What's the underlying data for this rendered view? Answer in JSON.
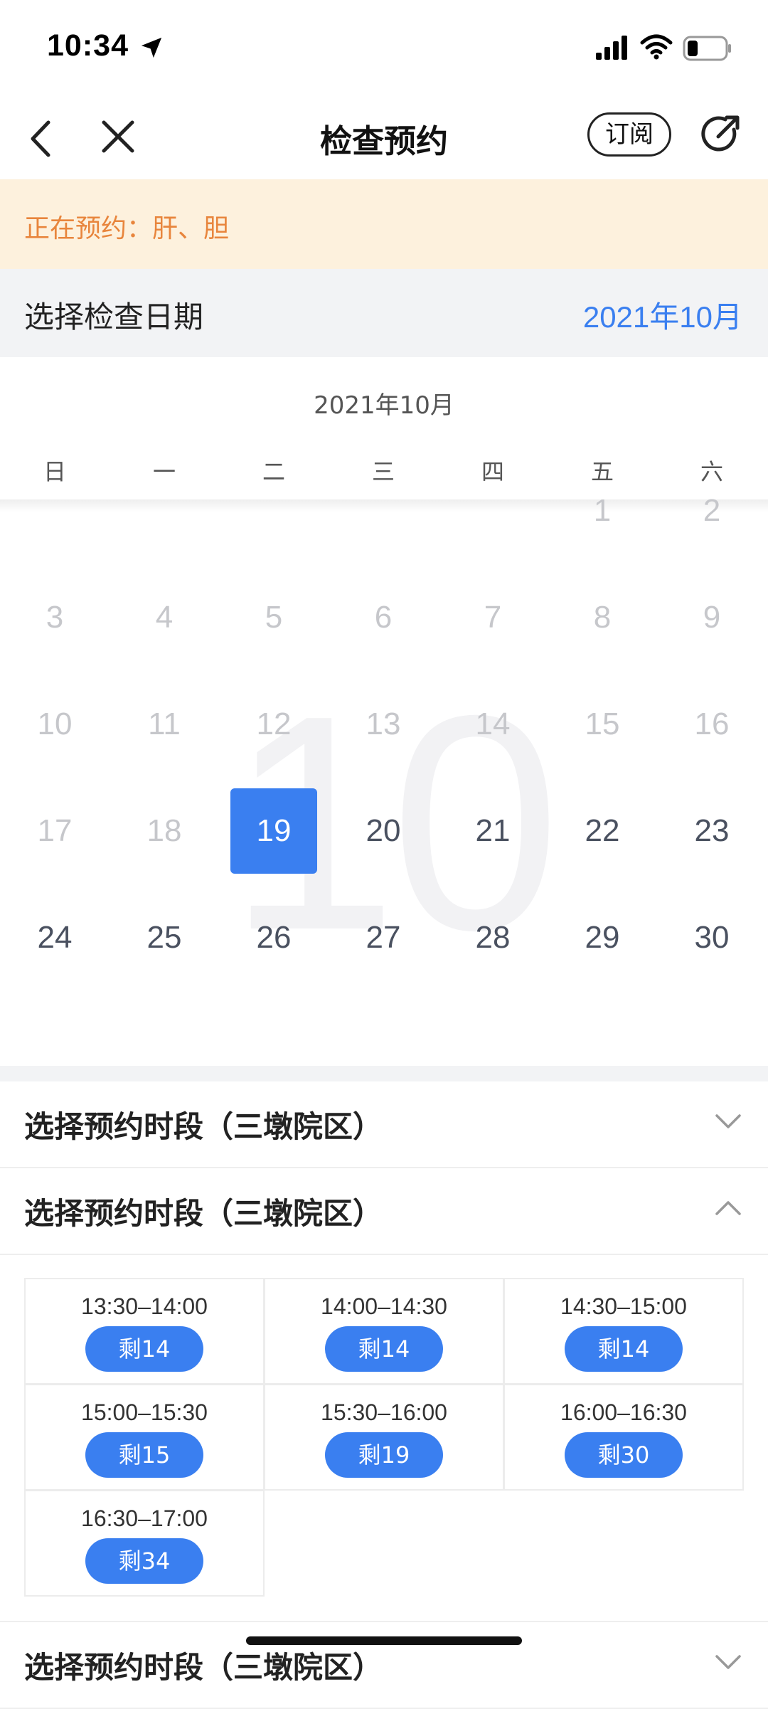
{
  "status_bar": {
    "time": "10:34"
  },
  "nav": {
    "title": "检查预约",
    "subscribe_label": "订阅"
  },
  "notice": {
    "text": "正在预约：肝、胆"
  },
  "date_header": {
    "label": "选择检查日期",
    "month": "2021年10月"
  },
  "calendar": {
    "month_label": "2021年10月",
    "watermark": "10",
    "weekdays": [
      "日",
      "一",
      "二",
      "三",
      "四",
      "五",
      "六"
    ],
    "days": [
      "1",
      "2",
      "3",
      "4",
      "5",
      "6",
      "7",
      "8",
      "9",
      "10",
      "11",
      "12",
      "13",
      "14",
      "15",
      "16",
      "17",
      "18",
      "19",
      "20",
      "21",
      "22",
      "23",
      "24",
      "25",
      "26",
      "27",
      "28",
      "29",
      "30"
    ],
    "selected_day": "19",
    "accent_color": "#3a7ff0"
  },
  "time_sections": [
    {
      "title": "选择预约时段（三墩院区）",
      "expanded": false
    },
    {
      "title": "选择预约时段（三墩院区）",
      "expanded": true
    },
    {
      "title": "选择预约时段（三墩院区）",
      "expanded": false
    }
  ],
  "slots": [
    {
      "time": "13:30–14:00",
      "remaining": "剩14"
    },
    {
      "time": "14:00–14:30",
      "remaining": "剩14"
    },
    {
      "time": "14:30–15:00",
      "remaining": "剩14"
    },
    {
      "time": "15:00–15:30",
      "remaining": "剩15"
    },
    {
      "time": "15:30–16:00",
      "remaining": "剩19"
    },
    {
      "time": "16:00–16:30",
      "remaining": "剩30"
    },
    {
      "time": "16:30–17:00",
      "remaining": "剩34"
    }
  ]
}
